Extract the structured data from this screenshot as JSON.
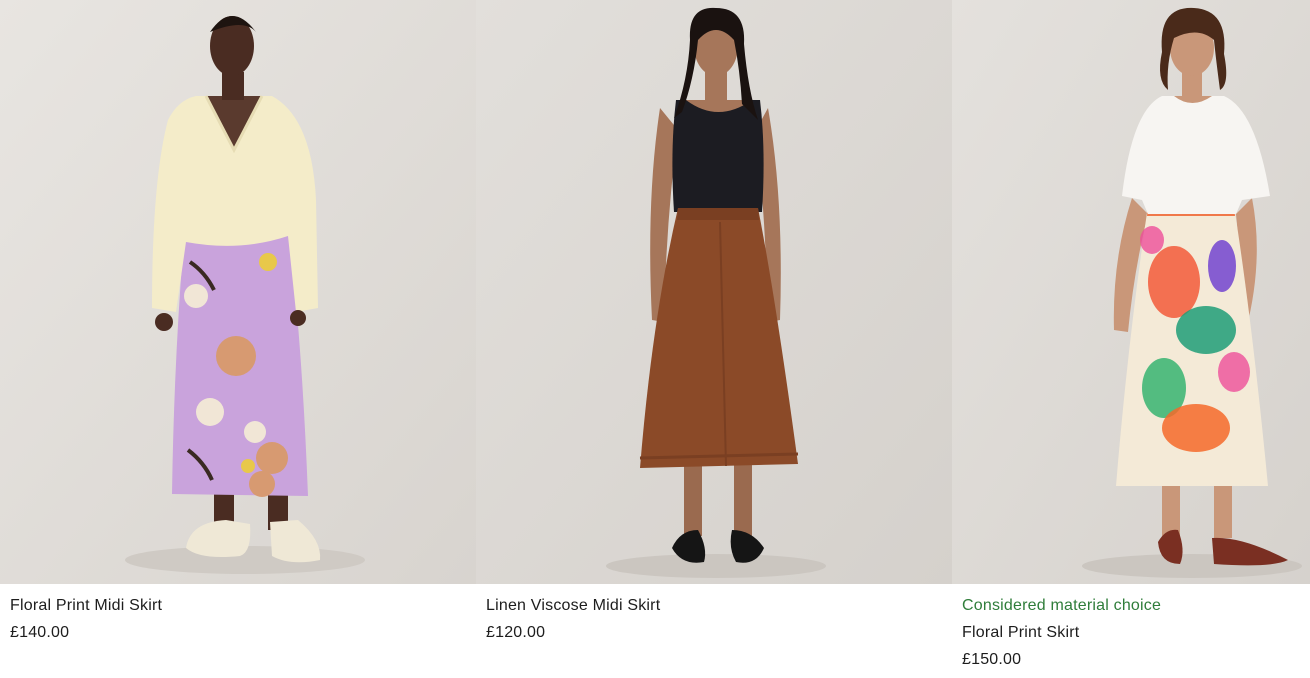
{
  "products": [
    {
      "name": "Floral Print Midi Skirt",
      "price": "£140.00"
    },
    {
      "name": "Linen Viscose Midi Skirt",
      "price": "£120.00"
    },
    {
      "badge": "Considered material choice",
      "name": "Floral Print Skirt",
      "price": "£150.00"
    }
  ],
  "colors": {
    "badge_green": "#2f7d3a",
    "text": "#1d1d1d",
    "photo_background": "#e4e1dd"
  }
}
